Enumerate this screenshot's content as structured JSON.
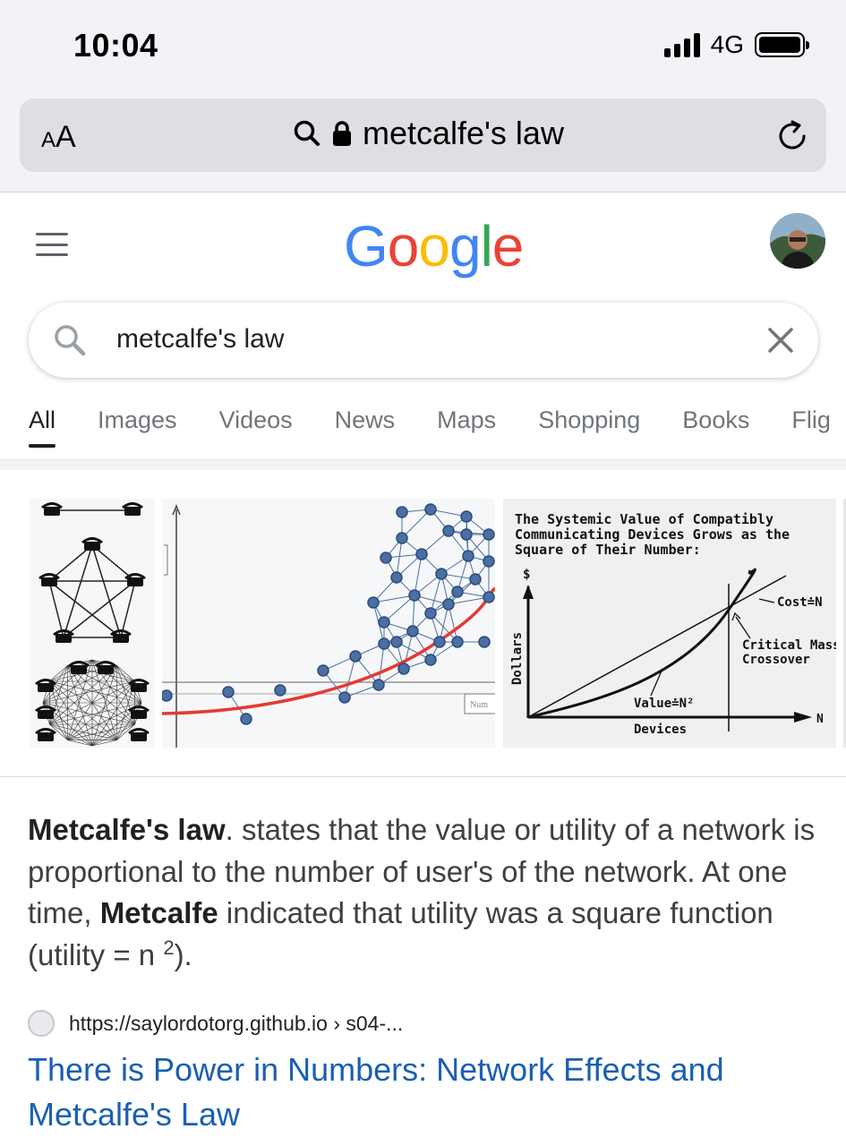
{
  "status_bar": {
    "time": "10:04",
    "network": "4G"
  },
  "browser": {
    "text_size_label_small": "A",
    "text_size_label_big": "A",
    "url_text": "metcalfe's law"
  },
  "header": {
    "logo_letters": [
      {
        "char": "G",
        "color": "#4285F4"
      },
      {
        "char": "o",
        "color": "#EA4335"
      },
      {
        "char": "o",
        "color": "#FBBC05"
      },
      {
        "char": "g",
        "color": "#4285F4"
      },
      {
        "char": "l",
        "color": "#34A853"
      },
      {
        "char": "e",
        "color": "#EA4335"
      }
    ]
  },
  "search": {
    "query": "metcalfe's law"
  },
  "tabs": [
    {
      "label": "All",
      "active": true
    },
    {
      "label": "Images"
    },
    {
      "label": "Videos"
    },
    {
      "label": "News"
    },
    {
      "label": "Maps"
    },
    {
      "label": "Shopping"
    },
    {
      "label": "Books"
    },
    {
      "label": "Flig"
    }
  ],
  "images": {
    "image3": {
      "title_line1": "The Systemic Value of Compatibly",
      "title_line2": "Communicating Devices Grows as the",
      "title_line3": "Square of Their Number:",
      "y_symbol": "$",
      "y_label": "Dollars",
      "x_label": "Devices",
      "x_symbol": "N",
      "cost_label": "Cost≐N",
      "crossover_line1": "Critical Mass",
      "crossover_line2": "Crossover",
      "value_label": "Value≐N²"
    },
    "image2": {
      "legend_fragment": "Num"
    }
  },
  "snippet": {
    "bold_term": "Metcalfe's law",
    "part1": ". states that the value or utility of a network is proportional to the number of user's of the network. At one time, ",
    "bold_name": "Metcalfe",
    "part2": " indicated that utility was a square function (utility = n ",
    "superscript": "2",
    "part3": ")."
  },
  "result": {
    "source_url": "https://saylordotorg.github.io › s04-...",
    "title": "There is Power in Numbers: Network Effects and Metcalfe's Law"
  },
  "colors": {
    "link": "#1a5fb4",
    "chart_red": "#e53935",
    "node_blue": "#4a6fa5"
  }
}
